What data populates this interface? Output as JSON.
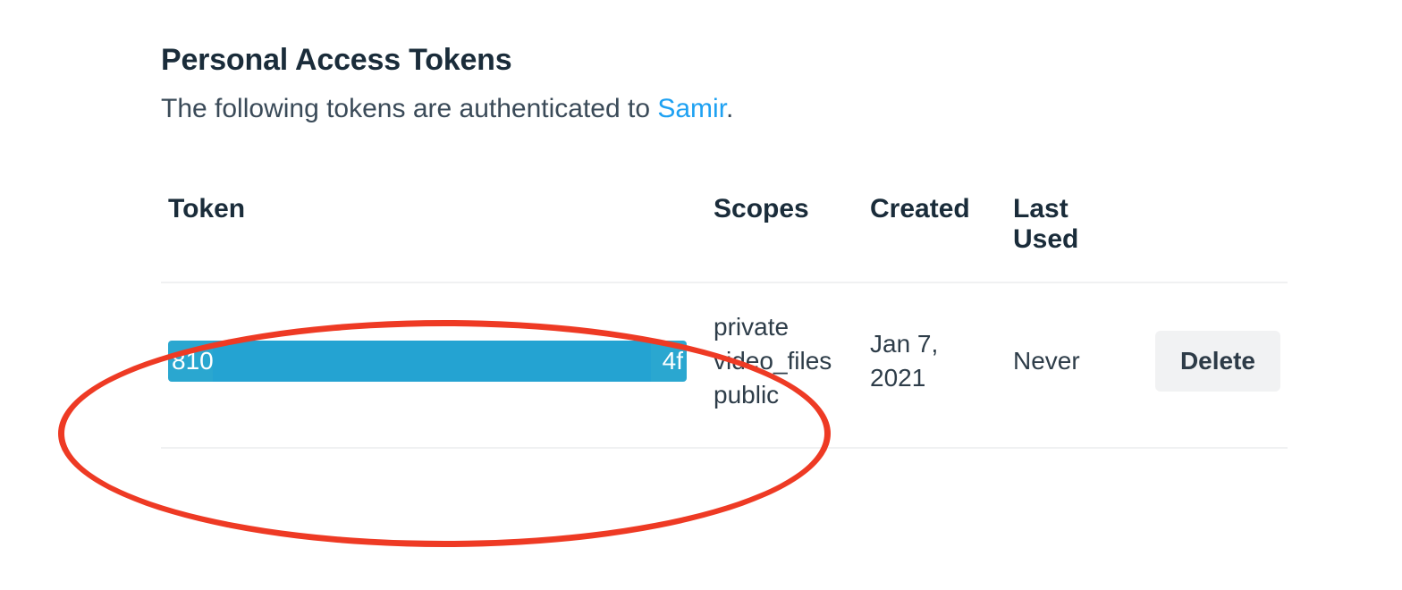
{
  "section": {
    "title": "Personal Access Tokens",
    "desc_prefix": "The following tokens are authenticated to ",
    "desc_user": "Samir",
    "desc_suffix": "."
  },
  "table": {
    "headers": {
      "token": "Token",
      "scopes": "Scopes",
      "created": "Created",
      "last_used": "Last Used"
    },
    "row": {
      "token_start": "810",
      "token_end": "4f",
      "scopes_line1": "private",
      "scopes_line2": "video_files",
      "scopes_line3": "public",
      "created": "Jan 7, 2021",
      "last_used": "Never",
      "delete_label": "Delete"
    }
  },
  "colors": {
    "link": "#1ea1f2",
    "selection": "#2aa7d0",
    "annotation": "#ee3a24"
  }
}
